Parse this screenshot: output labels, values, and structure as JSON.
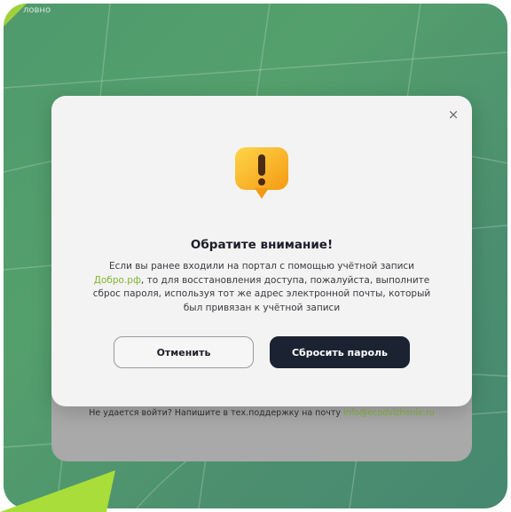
{
  "background": {
    "top_text": "ловно",
    "support": {
      "prefix": "Не удается войти? Напишите в тех.поддержку на почту ",
      "email": "info@ecodvizhenie.ru"
    }
  },
  "modal": {
    "close_icon": "×",
    "title": "Обратите внимание!",
    "message": {
      "part1": "Если вы ранее входили на портал с помощью учётной записи ",
      "link": "Добро.рф",
      "part2": ", то для восстановления доступа, пожалуйста, выполните сброс пароля, используя тот же адрес электронной почты, который был привязан к учётной записи"
    },
    "cancel_label": "Отменить",
    "reset_label": "Сбросить пароль"
  },
  "colors": {
    "accent": "#7fb534",
    "background": "#4f9a6d",
    "button_dark": "#1b2332",
    "warning": "#f6b41c"
  },
  "icons": {
    "warning": "exclamation-speech-bubble-icon",
    "close": "close-icon"
  }
}
